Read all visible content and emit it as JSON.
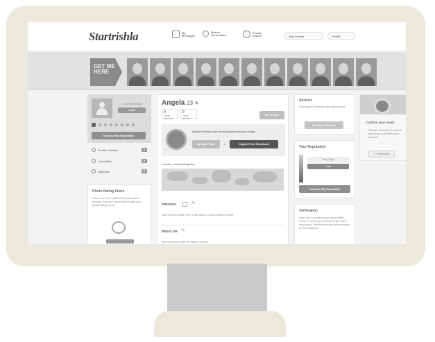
{
  "header": {
    "logo": "Startrishla",
    "nav": [
      {
        "label": "My Messages",
        "icon": "messages-icon"
      },
      {
        "label": "Mutual Connection",
        "icon": "heart-icon"
      },
      {
        "label": "People Search",
        "icon": "search-icon"
      }
    ],
    "credits_label": "Big Credits",
    "profile_label": "Profile"
  },
  "banner": {
    "get_me": "GET ME HERE"
  },
  "left": {
    "reputation_label": "Your Reputation",
    "reputation_value": "LOW",
    "increase_button": "Increase My Reputation",
    "menu": [
      {
        "label": "Profile Visitors",
        "icon": "eye-icon",
        "count": "0"
      },
      {
        "label": "Likes/Hits",
        "icon": "heart-icon",
        "count": "0"
      },
      {
        "label": "Blocked",
        "icon": "block-icon",
        "count": "0"
      }
    ],
    "photo_score_title": "Photo Rating Score",
    "photo_score_text": "There are over 3,000,987 photos here already. Add your photo now to get your photo rating score!"
  },
  "profile": {
    "name": "Angela",
    "age": "23",
    "stat1_value": "0",
    "stat1_label": "YOUR ACTIVITY",
    "stat2_value": "0",
    "stat2_label": "YOUR RATING",
    "my_photos_button": "My Photos",
    "upload_title": "Upload Photos and meet people near you today.",
    "upload_button": "Upload Photo",
    "or_label": "or",
    "import_button": "Import From Facebook",
    "location_label": "London, United Kingdom",
    "interests_label": "Interests",
    "interests_hint": "Add your interests here to get found by like-minded people",
    "about_label": "About me",
    "about_hint": "Tell everyone a little bit about yourself"
  },
  "right": {
    "stickers_title": "Stickers",
    "stickers_text": "You haven't collected any stickers yet.",
    "stickers_button": "Get More Stickers",
    "reputation_title": "Your Reputation",
    "rep_levels": [
      "Very High",
      "Low"
    ],
    "increase_button": "Increase My Reputation",
    "verification_title": "Verification",
    "verification_text": "Don't fall in, protect your real profiles. Prove to others you exist and get more responses. Verified account gives access to our audience."
  },
  "email_panel": {
    "title": "Confirm your email",
    "text": "Please remember to check any email and verify your account",
    "button": "Email sent"
  }
}
